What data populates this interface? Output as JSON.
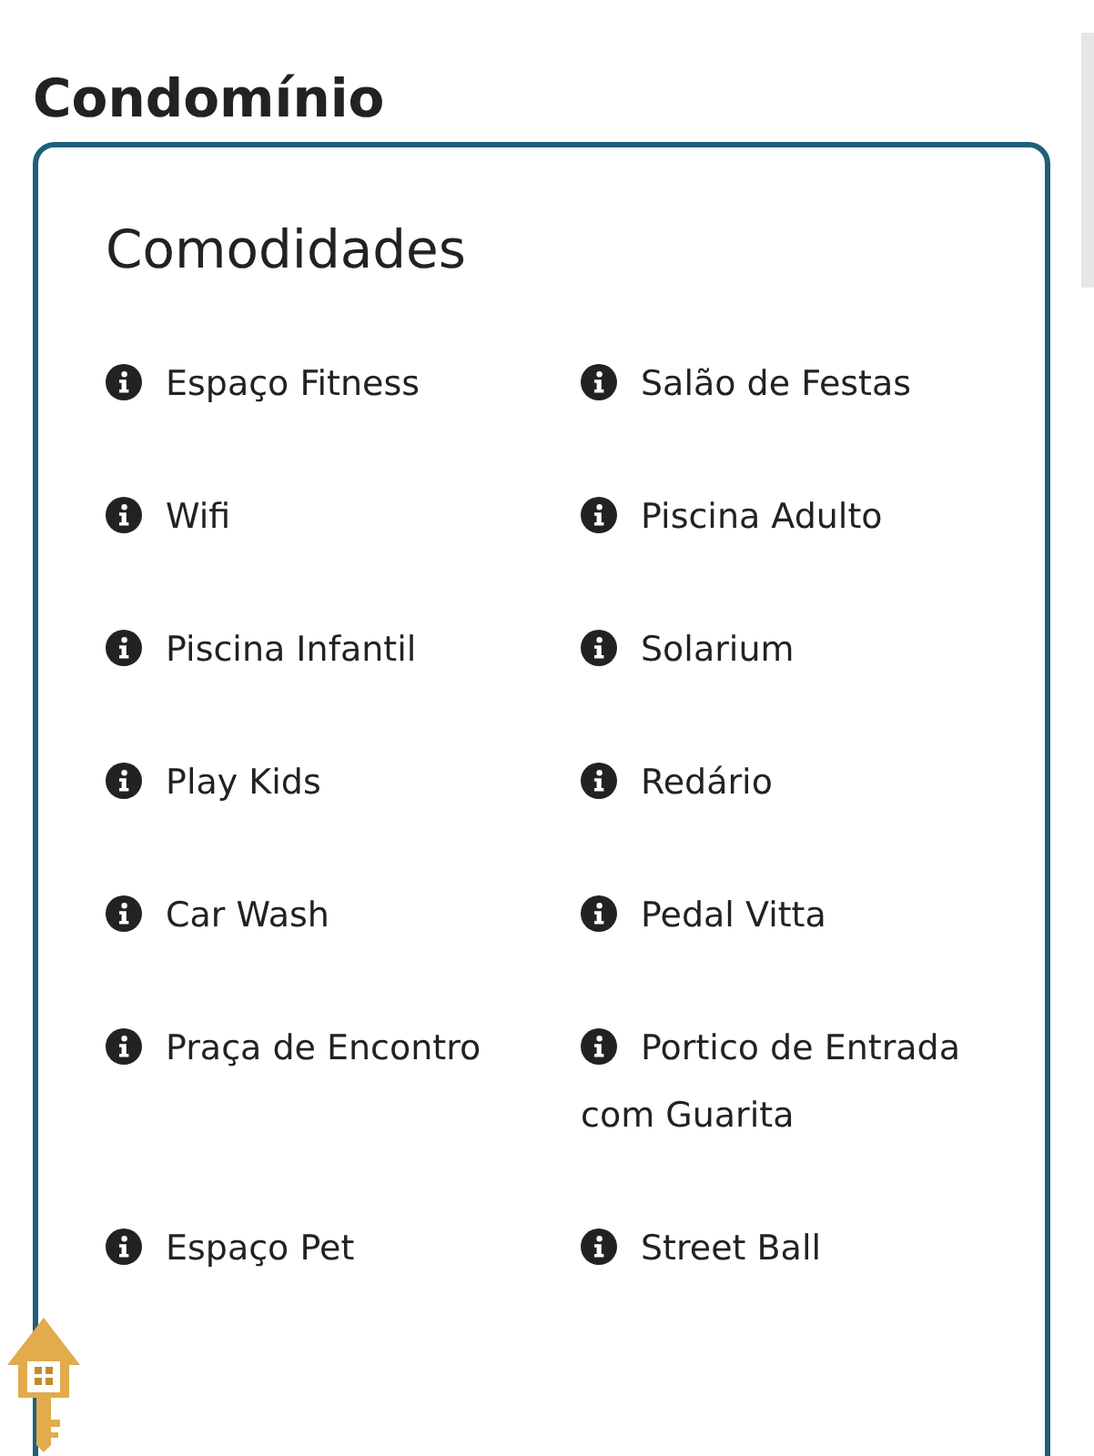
{
  "page_title": "Condomínio",
  "section": {
    "heading": "Comodidades",
    "items": [
      {
        "label": "Espaço Fitness"
      },
      {
        "label": "Salão de Festas"
      },
      {
        "label": "Wifi"
      },
      {
        "label": "Piscina Adulto"
      },
      {
        "label": "Piscina Infantil"
      },
      {
        "label": "Solarium"
      },
      {
        "label": "Play Kids"
      },
      {
        "label": "Redário"
      },
      {
        "label": "Car Wash"
      },
      {
        "label": "Pedal Vitta"
      },
      {
        "label": "Praça de Encontro"
      },
      {
        "label": "Portico de Entrada com Guarita"
      },
      {
        "label": "Espaço Pet"
      },
      {
        "label": "Street Ball"
      }
    ]
  }
}
